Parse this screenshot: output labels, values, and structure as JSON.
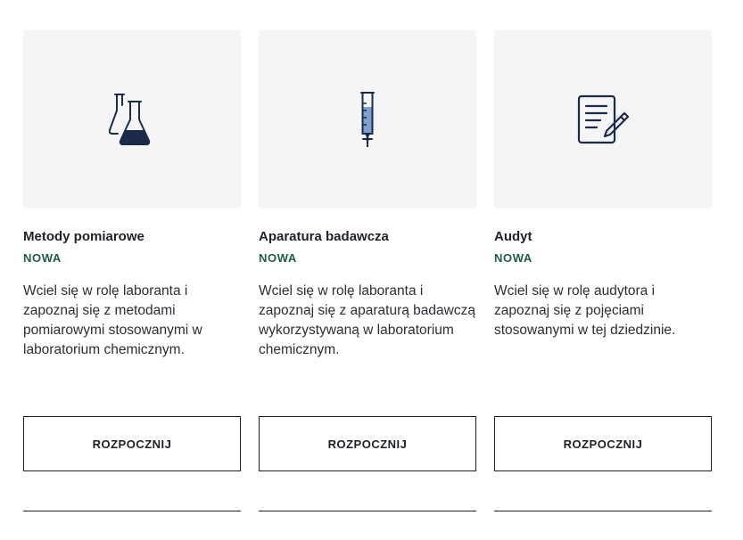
{
  "colors": {
    "accent": "#1e5e4a",
    "icon": "#1b2a4a",
    "tube_fill": "#7f9fd1",
    "card_bg": "#f5f5f5"
  },
  "cards": [
    {
      "icon": "flasks-icon",
      "title": "Metody pomiarowe",
      "badge": "NOWA",
      "description": "Wciel się w rolę laboranta i zapoznaj się z metodami pomiarowymi stosowanymi w laboratorium chemicznym.",
      "button_label": "ROZPOCZNIJ"
    },
    {
      "icon": "burette-icon",
      "title": "Aparatura badawcza",
      "badge": "NOWA",
      "description": "Wciel się w rolę laboranta i zapoznaj się z aparaturą badawczą wykorzystywaną w laboratorium chemicznym.",
      "button_label": "ROZPOCZNIJ"
    },
    {
      "icon": "document-pen-icon",
      "title": "Audyt",
      "badge": "NOWA",
      "description": "Wciel się w rolę audytora i zapoznaj się z pojęciami stosowanymi w tej dziedzinie.",
      "button_label": "ROZPOCZNIJ"
    }
  ]
}
